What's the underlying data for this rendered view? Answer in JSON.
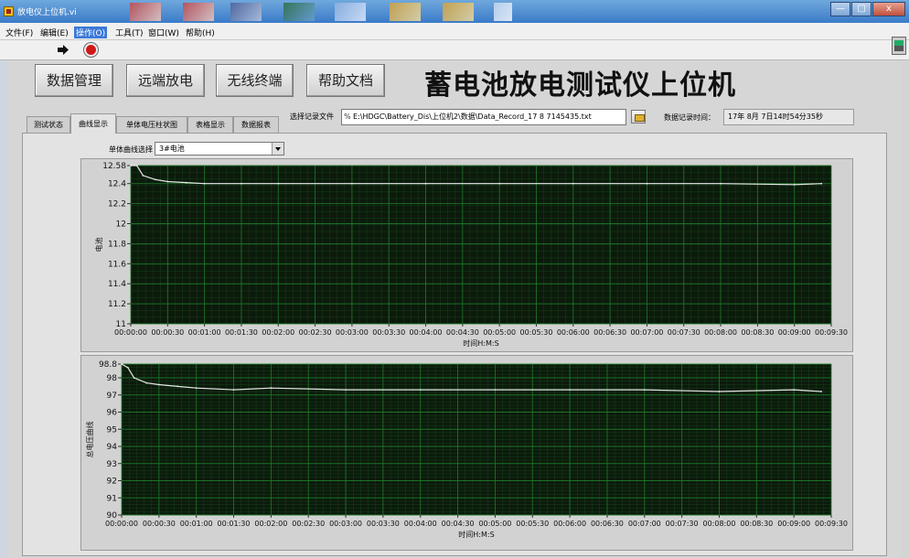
{
  "window": {
    "title": "放电仪上位机.vi",
    "controls": [
      "—",
      "□",
      "x"
    ]
  },
  "menu": [
    "文件(F)",
    "编辑(E)",
    "操作(O)",
    "工具(T)",
    "窗口(W)",
    "帮助(H)"
  ],
  "toolbar": {
    "run": "run-arrow-icon",
    "stop": "stop-icon"
  },
  "buttons": [
    "数据管理",
    "远端放电",
    "无线终端",
    "帮助文档"
  ],
  "app_title": "蓄电池放电测试仪上位机",
  "tabs": [
    "测试状态",
    "曲线显示",
    "单体电压柱状图",
    "表格显示",
    "数据报表"
  ],
  "active_tab": "曲线显示",
  "file": {
    "label": "选择记录文件",
    "path_glyph": "%",
    "path": "E:\\HDGC\\Battery_Dis\\上位机2\\数据\\Data_Record_17 8 7145435.txt"
  },
  "record_time": {
    "label": "数据记录时间：",
    "value": "17年 8月 7日14时54分35秒"
  },
  "selector": {
    "label": "单体曲线选择",
    "value": "3#电池"
  },
  "colors": {
    "plot_bg": "#0c1a0c",
    "grid": "#1f7a2a",
    "trace": "#e8e8e8",
    "panel": "#d6d6d6"
  },
  "chart_data": [
    {
      "type": "line",
      "title": "",
      "xlabel": "时间H:M:S",
      "ylabel": "电池",
      "ylim": [
        11,
        12.58
      ],
      "yticks": [
        "11",
        "11.2",
        "11.4",
        "11.6",
        "11.8",
        "12",
        "12.2",
        "12.4",
        "12.58"
      ],
      "xticks": [
        "00:00:00",
        "00:00:30",
        "00:01:00",
        "00:01:30",
        "00:02:00",
        "00:02:30",
        "00:03:00",
        "00:03:30",
        "00:04:00",
        "00:04:30",
        "00:05:00",
        "00:05:30",
        "00:06:00",
        "00:06:30",
        "00:07:00",
        "00:07:30",
        "00:08:00",
        "00:08:30",
        "00:09:00",
        "00:09:30"
      ],
      "x_seconds": [
        0,
        5,
        10,
        20,
        30,
        45,
        60,
        90,
        120,
        180,
        240,
        300,
        360,
        420,
        480,
        540,
        562
      ],
      "values": [
        12.58,
        12.58,
        12.48,
        12.44,
        12.42,
        12.41,
        12.4,
        12.4,
        12.4,
        12.4,
        12.4,
        12.4,
        12.4,
        12.4,
        12.4,
        12.39,
        12.4
      ],
      "grid": true
    },
    {
      "type": "line",
      "title": "",
      "xlabel": "时间H:M:S",
      "ylabel": "总电压曲线",
      "ylim": [
        90,
        98.8
      ],
      "yticks": [
        "90",
        "91",
        "92",
        "93",
        "94",
        "95",
        "96",
        "97",
        "98",
        "98.8"
      ],
      "xticks": [
        "00:00:00",
        "00:00:30",
        "00:01:00",
        "00:01:30",
        "00:02:00",
        "00:02:30",
        "00:03:00",
        "00:03:30",
        "00:04:00",
        "00:04:30",
        "00:05:00",
        "00:05:30",
        "00:06:00",
        "00:06:30",
        "00:07:00",
        "00:07:30",
        "00:08:00",
        "00:08:30",
        "00:09:00",
        "00:09:30"
      ],
      "x_seconds": [
        0,
        5,
        10,
        20,
        30,
        45,
        60,
        90,
        120,
        180,
        240,
        300,
        360,
        420,
        480,
        540,
        562
      ],
      "values": [
        98.8,
        98.6,
        98.0,
        97.7,
        97.6,
        97.5,
        97.4,
        97.3,
        97.4,
        97.3,
        97.3,
        97.3,
        97.3,
        97.3,
        97.2,
        97.3,
        97.2
      ],
      "grid": true
    }
  ]
}
